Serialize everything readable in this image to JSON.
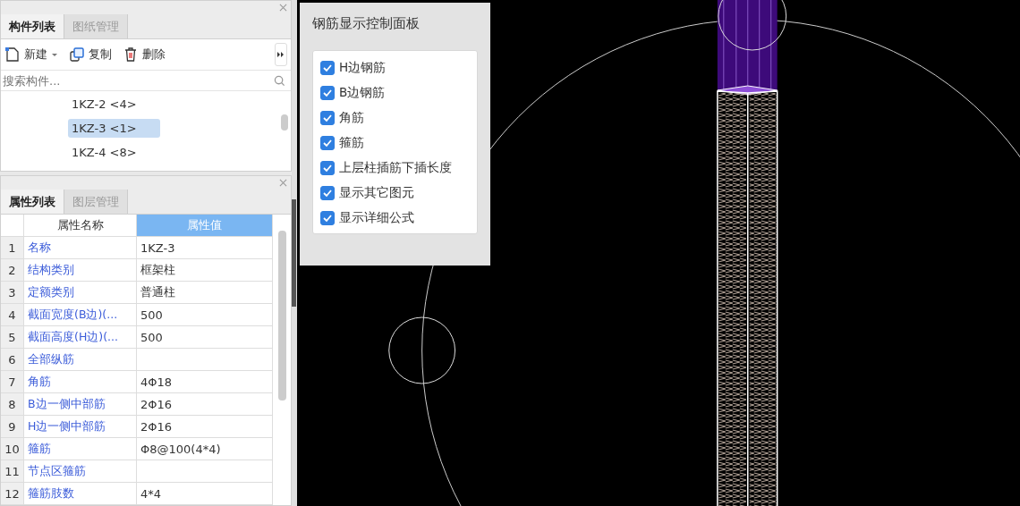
{
  "component_panel": {
    "tabs": [
      {
        "label": "构件列表",
        "selected": true
      },
      {
        "label": "图纸管理",
        "selected": false
      }
    ],
    "toolbar": [
      {
        "kind": "new",
        "label": "新建"
      },
      {
        "kind": "copy",
        "label": "复制"
      },
      {
        "kind": "delete",
        "label": "删除"
      }
    ],
    "search": {
      "placeholder": "搜索构件..."
    },
    "items": [
      {
        "label": "1KZ-2 <4>",
        "selected": false
      },
      {
        "label": "1KZ-3 <1>",
        "selected": true
      },
      {
        "label": "1KZ-4 <8>",
        "selected": false
      }
    ]
  },
  "property_panel": {
    "tabs": [
      {
        "label": "属性列表",
        "selected": true
      },
      {
        "label": "图层管理",
        "selected": false
      }
    ],
    "columns": [
      "属性名称",
      "属性值"
    ],
    "rows": [
      {
        "index": "1",
        "name": "名称",
        "value": "1KZ-3"
      },
      {
        "index": "2",
        "name": "结构类别",
        "value": "框架柱"
      },
      {
        "index": "3",
        "name": "定额类别",
        "value": "普通柱"
      },
      {
        "index": "4",
        "name": "截面宽度(B边)(...",
        "value": "500"
      },
      {
        "index": "5",
        "name": "截面高度(H边)(...",
        "value": "500"
      },
      {
        "index": "6",
        "name": "全部纵筋",
        "value": ""
      },
      {
        "index": "7",
        "name": "角筋",
        "value": "4Φ18"
      },
      {
        "index": "8",
        "name": "B边一侧中部筋",
        "value": "2Φ16"
      },
      {
        "index": "9",
        "name": "H边一侧中部筋",
        "value": "2Φ16"
      },
      {
        "index": "10",
        "name": "箍筋",
        "value": "Φ8@100(4*4)"
      },
      {
        "index": "11",
        "name": "节点区箍筋",
        "value": ""
      },
      {
        "index": "12",
        "name": "箍筋肢数",
        "value": "4*4"
      }
    ]
  },
  "rebar_panel": {
    "title": "钢筋显示控制面板",
    "options": [
      {
        "label": "H边钢筋",
        "checked": true
      },
      {
        "label": "B边钢筋",
        "checked": true
      },
      {
        "label": "角筋",
        "checked": true
      },
      {
        "label": "箍筋",
        "checked": true
      },
      {
        "label": "上层柱插筋下插长度",
        "checked": true
      },
      {
        "label": "显示其它图元",
        "checked": true
      },
      {
        "label": "显示详细公式",
        "checked": true
      }
    ]
  }
}
